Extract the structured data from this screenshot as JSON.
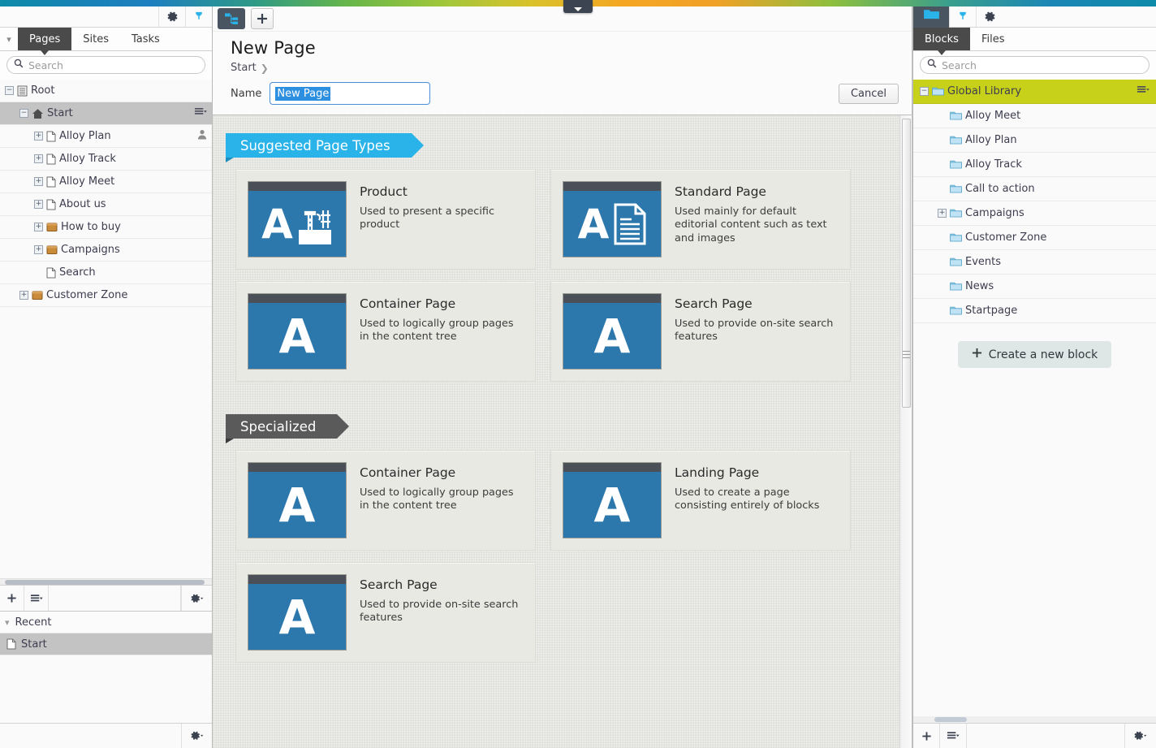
{
  "gradient_tab": {
    "icon": "chevron-down-icon"
  },
  "left_panel": {
    "toolbar": {
      "gear": "gear-icon",
      "pin": "pin-icon"
    },
    "collapse_icon": "chevron-down-icon",
    "tabs": [
      {
        "label": "Pages",
        "active": true
      },
      {
        "label": "Sites",
        "active": false
      },
      {
        "label": "Tasks",
        "active": false
      }
    ],
    "search": {
      "placeholder": "Search",
      "value": ""
    },
    "tree": [
      {
        "label": "Root",
        "indent": 0,
        "toggle": "minus",
        "icon": "list-icon",
        "selected": false,
        "menu": false,
        "user": false
      },
      {
        "label": "Start",
        "indent": 1,
        "toggle": "minus",
        "icon": "home-icon",
        "selected": true,
        "menu": true,
        "user": false
      },
      {
        "label": "Alloy Plan",
        "indent": 2,
        "toggle": "plus",
        "icon": "page-icon",
        "selected": false,
        "menu": false,
        "user": true
      },
      {
        "label": "Alloy Track",
        "indent": 2,
        "toggle": "plus",
        "icon": "page-icon",
        "selected": false,
        "menu": false,
        "user": false
      },
      {
        "label": "Alloy Meet",
        "indent": 2,
        "toggle": "plus",
        "icon": "page-icon",
        "selected": false,
        "menu": false,
        "user": false
      },
      {
        "label": "About us",
        "indent": 2,
        "toggle": "plus",
        "icon": "page-icon",
        "selected": false,
        "menu": false,
        "user": false
      },
      {
        "label": "How to buy",
        "indent": 2,
        "toggle": "plus",
        "icon": "container-icon",
        "selected": false,
        "menu": false,
        "user": false
      },
      {
        "label": "Campaigns",
        "indent": 2,
        "toggle": "plus",
        "icon": "container-icon",
        "selected": false,
        "menu": false,
        "user": false
      },
      {
        "label": "Search",
        "indent": 2,
        "toggle": "none",
        "icon": "page-icon",
        "selected": false,
        "menu": false,
        "user": false
      },
      {
        "label": "Customer Zone",
        "indent": 1,
        "toggle": "plus",
        "icon": "container-icon",
        "selected": false,
        "menu": false,
        "user": false
      }
    ],
    "bottom_toolbar": {
      "add": "plus-icon",
      "menu": "list-menu-icon",
      "settings": "gear-dropdown-icon"
    },
    "recent": {
      "header": "Recent",
      "items": [
        {
          "label": "Start",
          "selected": true
        }
      ],
      "settings": "gear-dropdown-icon"
    }
  },
  "main": {
    "toolbar": {
      "tree_view": "sitemap-icon",
      "add": "plus-icon"
    },
    "title": "New Page",
    "breadcrumb": [
      "Start"
    ],
    "name_label": "Name",
    "name_value": "New Page",
    "cancel_label": "Cancel",
    "sections": [
      {
        "heading": "Suggested Page Types",
        "style": "blue",
        "cards": [
          {
            "title": "Product",
            "desc": "Used to present a specific product",
            "thumb": "letter-a-crane-icon"
          },
          {
            "title": "Standard Page",
            "desc": "Used mainly for default editorial content such as text and images",
            "thumb": "letter-a-document-icon"
          },
          {
            "title": "Container Page",
            "desc": "Used to logically group pages in the content tree",
            "thumb": "letter-a-icon"
          },
          {
            "title": "Search Page",
            "desc": "Used to provide on-site search features",
            "thumb": "letter-a-icon"
          }
        ]
      },
      {
        "heading": "Specialized",
        "style": "gray",
        "cards": [
          {
            "title": "Container Page",
            "desc": "Used to logically group pages in the content tree",
            "thumb": "letter-a-icon"
          },
          {
            "title": "Landing Page",
            "desc": "Used to create a page consisting entirely of blocks",
            "thumb": "letter-a-icon"
          },
          {
            "title": "Search Page",
            "desc": "Used to provide on-site search features",
            "thumb": "letter-a-icon"
          }
        ]
      }
    ]
  },
  "right_panel": {
    "toolbar": {
      "folder_view": "folder-icon",
      "pin": "pin-icon",
      "gear": "gear-icon"
    },
    "tabs": [
      {
        "label": "Blocks",
        "active": true
      },
      {
        "label": "Files",
        "active": false
      }
    ],
    "search": {
      "placeholder": "Search",
      "value": ""
    },
    "tree": [
      {
        "label": "Global Library",
        "indent": 0,
        "toggle": "minus",
        "highlight": true,
        "menu": true
      },
      {
        "label": "Alloy Meet",
        "indent": 1,
        "toggle": "none",
        "highlight": false,
        "menu": false
      },
      {
        "label": "Alloy Plan",
        "indent": 1,
        "toggle": "none",
        "highlight": false,
        "menu": false
      },
      {
        "label": "Alloy Track",
        "indent": 1,
        "toggle": "none",
        "highlight": false,
        "menu": false
      },
      {
        "label": "Call to action",
        "indent": 1,
        "toggle": "none",
        "highlight": false,
        "menu": false
      },
      {
        "label": "Campaigns",
        "indent": 1,
        "toggle": "plus",
        "highlight": false,
        "menu": false
      },
      {
        "label": "Customer Zone",
        "indent": 1,
        "toggle": "none",
        "highlight": false,
        "menu": false
      },
      {
        "label": "Events",
        "indent": 1,
        "toggle": "none",
        "highlight": false,
        "menu": false
      },
      {
        "label": "News",
        "indent": 1,
        "toggle": "none",
        "highlight": false,
        "menu": false
      },
      {
        "label": "Startpage",
        "indent": 1,
        "toggle": "none",
        "highlight": false,
        "menu": false
      }
    ],
    "create_block_label": "Create a new block",
    "bottom_toolbar": {
      "add": "plus-icon",
      "menu": "list-menu-icon",
      "settings": "gear-dropdown-icon"
    }
  },
  "colors": {
    "accent_blue": "#29b3e8",
    "highlight_green": "#c7d11a",
    "thumb_blue": "#2c78ad",
    "selection_blue": "#2d8fe0",
    "dark_gray": "#5a5a5a"
  }
}
